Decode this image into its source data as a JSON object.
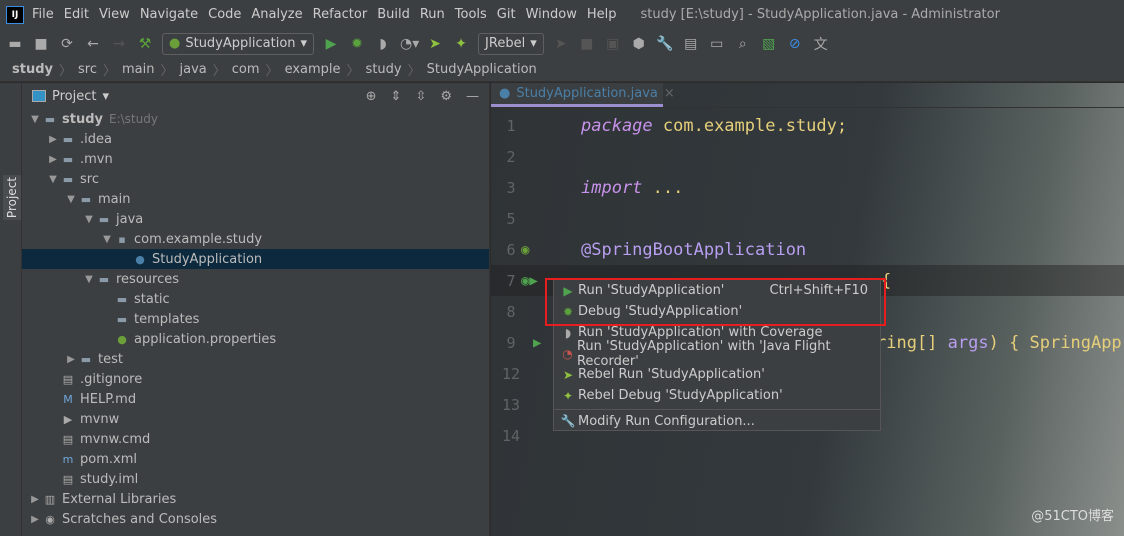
{
  "menubar": {
    "items": [
      "File",
      "Edit",
      "View",
      "Navigate",
      "Code",
      "Analyze",
      "Refactor",
      "Build",
      "Run",
      "Tools",
      "Git",
      "Window",
      "Help"
    ],
    "title": "study [E:\\study] - StudyApplication.java - Administrator"
  },
  "toolbar": {
    "run_config": "StudyApplication",
    "jrebel": "JRebel"
  },
  "breadcrumb": [
    "study",
    "src",
    "main",
    "java",
    "com",
    "example",
    "study",
    "StudyApplication"
  ],
  "side_tab": "Project",
  "project": {
    "title": "Project",
    "tree": [
      {
        "label": "study",
        "hint": "E:\\study",
        "depth": 0,
        "arrow": "down",
        "icon": "folder"
      },
      {
        "label": ".idea",
        "depth": 1,
        "arrow": "right",
        "icon": "folder"
      },
      {
        "label": ".mvn",
        "depth": 1,
        "arrow": "right",
        "icon": "folder"
      },
      {
        "label": "src",
        "depth": 1,
        "arrow": "down",
        "icon": "folder"
      },
      {
        "label": "main",
        "depth": 2,
        "arrow": "down",
        "icon": "folder"
      },
      {
        "label": "java",
        "depth": 3,
        "arrow": "down",
        "icon": "folder"
      },
      {
        "label": "com.example.study",
        "depth": 4,
        "arrow": "down",
        "icon": "package"
      },
      {
        "label": "StudyApplication",
        "depth": 5,
        "arrow": "",
        "icon": "spring-class",
        "selected": true
      },
      {
        "label": "resources",
        "depth": 3,
        "arrow": "down",
        "icon": "folder"
      },
      {
        "label": "static",
        "depth": 4,
        "arrow": "",
        "icon": "folder"
      },
      {
        "label": "templates",
        "depth": 4,
        "arrow": "",
        "icon": "folder"
      },
      {
        "label": "application.properties",
        "depth": 4,
        "arrow": "",
        "icon": "properties"
      },
      {
        "label": "test",
        "depth": 2,
        "arrow": "right",
        "icon": "folder"
      },
      {
        "label": ".gitignore",
        "depth": 1,
        "arrow": "",
        "icon": "file"
      },
      {
        "label": "HELP.md",
        "depth": 1,
        "arrow": "",
        "icon": "md"
      },
      {
        "label": "mvnw",
        "depth": 1,
        "arrow": "",
        "icon": "script"
      },
      {
        "label": "mvnw.cmd",
        "depth": 1,
        "arrow": "",
        "icon": "file"
      },
      {
        "label": "pom.xml",
        "depth": 1,
        "arrow": "",
        "icon": "maven"
      },
      {
        "label": "study.iml",
        "depth": 1,
        "arrow": "",
        "icon": "file"
      },
      {
        "label": "External Libraries",
        "depth": 0,
        "arrow": "right",
        "icon": "library"
      },
      {
        "label": "Scratches and Consoles",
        "depth": 0,
        "arrow": "right",
        "icon": "scratch"
      }
    ]
  },
  "editor": {
    "tab": "StudyApplication.java",
    "lines": [
      {
        "n": "1",
        "parts": [
          [
            "kw",
            "package"
          ],
          [
            "pk",
            " com.example.study;"
          ]
        ]
      },
      {
        "n": "2",
        "parts": []
      },
      {
        "n": "3",
        "parts": [
          [
            "kw",
            "import"
          ],
          [
            "pk",
            " ..."
          ]
        ]
      },
      {
        "n": "5",
        "parts": []
      },
      {
        "n": "6",
        "parts": [
          [
            "an",
            "@SpringBootApplication"
          ]
        ]
      },
      {
        "n": "7",
        "parts": [
          [
            "pk",
            "{"
          ]
        ]
      },
      {
        "n": "8",
        "parts": []
      },
      {
        "n": "9",
        "parts": [
          [
            "pk",
            "ring[] "
          ],
          [
            "an",
            "args"
          ],
          [
            "pk",
            ") { SpringApp"
          ]
        ]
      },
      {
        "n": "12",
        "parts": []
      },
      {
        "n": "13",
        "parts": []
      },
      {
        "n": "14",
        "parts": []
      }
    ]
  },
  "popup": {
    "items": [
      {
        "icon": "run",
        "label": "Run 'StudyApplication'",
        "shortcut": "Ctrl+Shift+F10",
        "color": "#4fa34f"
      },
      {
        "icon": "debug",
        "label": "Debug 'StudyApplication'",
        "color": "#5aa33c"
      },
      {
        "icon": "coverage",
        "label": "Run 'StudyApplication' with Coverage",
        "color": "#aaa"
      },
      {
        "icon": "profiler",
        "label": "Run 'StudyApplication' with 'Java Flight Recorder'",
        "color": "#c75450"
      },
      {
        "icon": "rebel-run",
        "label": "Rebel Run 'StudyApplication'",
        "color": "#8fc140"
      },
      {
        "icon": "rebel-debug",
        "label": "Rebel Debug 'StudyApplication'",
        "color": "#8fc140"
      },
      {
        "icon": "wrench",
        "label": "Modify Run Configuration...",
        "color": "#ccc"
      }
    ]
  },
  "watermark": "@51CTO博客"
}
